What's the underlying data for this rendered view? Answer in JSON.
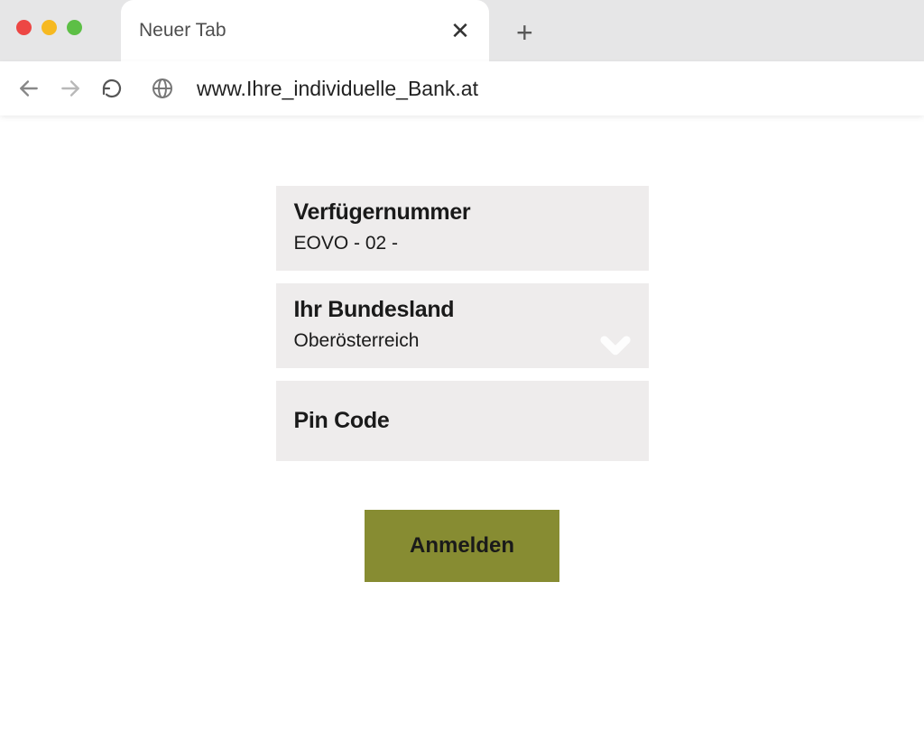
{
  "browser": {
    "tab_title": "Neuer Tab",
    "url": "www.Ihre_individuelle_Bank.at"
  },
  "form": {
    "verfueger": {
      "label": "Verfügernummer",
      "value": "EOVO - 02 -"
    },
    "bundesland": {
      "label": "Ihr Bundesland",
      "value": "Oberösterreich"
    },
    "pin": {
      "label": "Pin Code"
    },
    "submit_label": "Anmelden"
  }
}
